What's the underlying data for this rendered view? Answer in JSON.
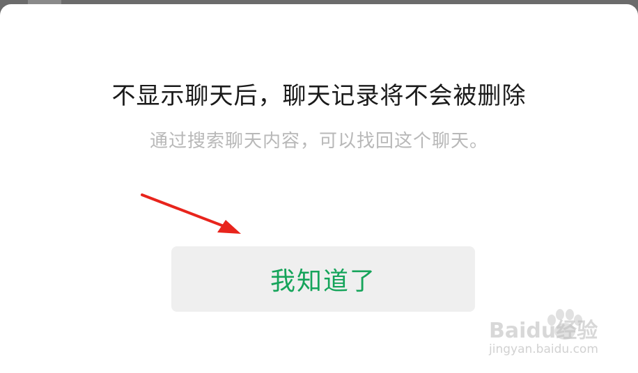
{
  "dialog": {
    "title": "不显示聊天后，聊天记录将不会被删除",
    "subtitle": "通过搜索聊天内容，可以找回这个聊天。",
    "confirm_label": "我知道了"
  },
  "annotation": {
    "arrow_color": "#e8241c"
  },
  "watermark": {
    "brand": "Baidu经验",
    "url": "jingyan.baidu.com"
  },
  "colors": {
    "accent_green": "#15a45a",
    "title_text": "#1a1a1a",
    "subtitle_text": "#b8b8b8",
    "button_bg": "#efefef"
  }
}
